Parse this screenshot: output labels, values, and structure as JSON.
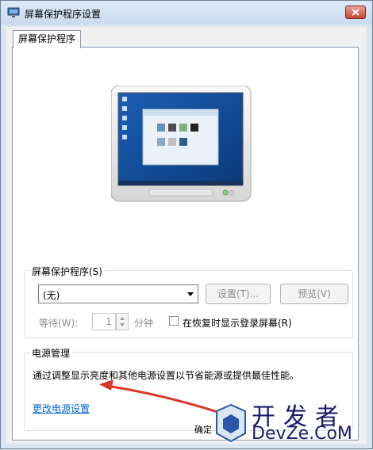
{
  "window": {
    "title": "屏幕保护程序设置"
  },
  "tabs": [
    {
      "label": "屏幕保护程序"
    }
  ],
  "screensaver_group": {
    "legend": "屏幕保护程序(S)",
    "selected": "(无)",
    "settings_label": "设置(T)...",
    "preview_label": "预览(V)",
    "wait_label": "等待(W):",
    "wait_value": "1",
    "minutes_label": "分钟",
    "resume_checkbox_label": "在恢复时显示登录屏幕(R)",
    "resume_checked": false
  },
  "power_group": {
    "legend": "电源管理",
    "description": "通过调整显示亮度和其他电源设置以节省能源或提供最佳性能。",
    "link": "更改电源设置"
  },
  "footer": {
    "ok_label": "确定"
  },
  "watermark": {
    "cn": "开发者",
    "en": "DevZe.CoM"
  },
  "colors": {
    "link": "#0066cc",
    "arrow": "#d9362b",
    "accent": "#1b1b6b"
  }
}
